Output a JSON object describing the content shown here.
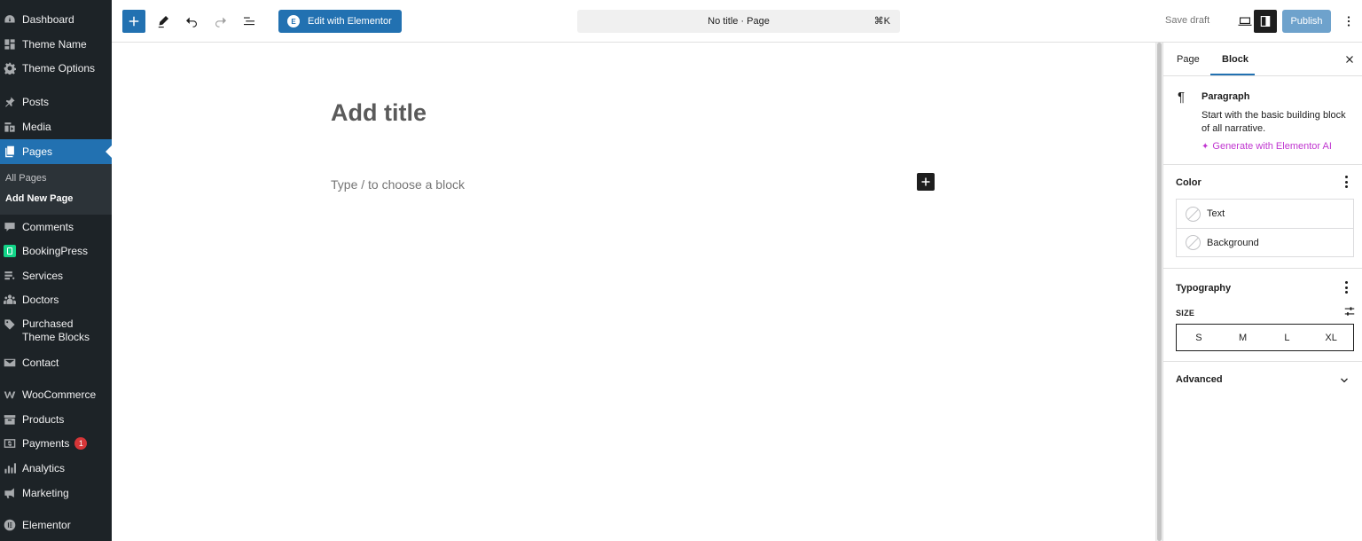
{
  "admin_menu": {
    "items": [
      {
        "key": "dashboard",
        "label": "Dashboard",
        "icon": "dashboard-icon"
      },
      {
        "key": "theme-name",
        "label": "Theme Name",
        "icon": "layout-icon"
      },
      {
        "key": "theme-options",
        "label": "Theme Options",
        "icon": "gear-icon"
      },
      {
        "key": "posts",
        "label": "Posts",
        "icon": "pin-icon"
      },
      {
        "key": "media",
        "label": "Media",
        "icon": "media-icon"
      },
      {
        "key": "pages",
        "label": "Pages",
        "icon": "pages-icon"
      },
      {
        "key": "comments",
        "label": "Comments",
        "icon": "comment-icon"
      },
      {
        "key": "bookingpress",
        "label": "BookingPress",
        "icon": "bookingpress-icon"
      },
      {
        "key": "services",
        "label": "Services",
        "icon": "services-icon"
      },
      {
        "key": "doctors",
        "label": "Doctors",
        "icon": "group-icon"
      },
      {
        "key": "purchased-theme-blocks",
        "label": "Purchased Theme Blocks",
        "icon": "tag-icon"
      },
      {
        "key": "contact",
        "label": "Contact",
        "icon": "mail-icon"
      },
      {
        "key": "woocommerce",
        "label": "WooCommerce",
        "icon": "woocommerce-icon"
      },
      {
        "key": "products",
        "label": "Products",
        "icon": "archive-icon"
      },
      {
        "key": "payments",
        "label": "Payments",
        "icon": "dollar-icon",
        "badge": "1"
      },
      {
        "key": "analytics",
        "label": "Analytics",
        "icon": "bar-chart-icon"
      },
      {
        "key": "marketing",
        "label": "Marketing",
        "icon": "megaphone-icon"
      },
      {
        "key": "elementor",
        "label": "Elementor",
        "icon": "elementor-icon"
      }
    ],
    "active": "pages",
    "submenu": [
      "All Pages",
      "Add New Page"
    ],
    "submenu_current": "Add New Page"
  },
  "toolbar": {
    "elementor_button": "Edit with Elementor",
    "command_title": "No title · Page",
    "command_shortcut": "⌘K",
    "save_draft": "Save draft",
    "publish": "Publish"
  },
  "editor": {
    "title_placeholder": "Add title",
    "block_placeholder": "Type / to choose a block"
  },
  "panel": {
    "tabs": [
      "Page",
      "Block"
    ],
    "active_tab": "Block",
    "block": {
      "name": "Paragraph",
      "description": "Start with the basic building block of all narrative.",
      "ai_link": "Generate with Elementor AI"
    },
    "color": {
      "title": "Color",
      "options": [
        "Text",
        "Background"
      ]
    },
    "typography": {
      "title": "Typography",
      "size_label": "SIZE",
      "sizes": [
        "S",
        "M",
        "L",
        "XL"
      ]
    },
    "advanced": {
      "title": "Advanced"
    }
  },
  "colors": {
    "admin_bg": "#1d2327",
    "accent": "#2271b1",
    "badge": "#d63638",
    "ai_link": "#c036d0"
  }
}
